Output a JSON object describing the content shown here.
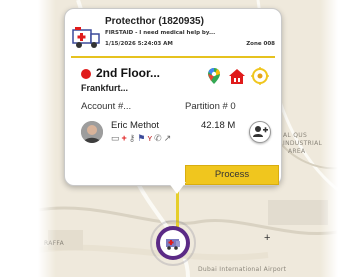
{
  "incident": {
    "title": "Protecthor (1820935)",
    "description": "FIRSTAID - I need medical help by...",
    "datetime": "1/15/2026 5:24:03 AM",
    "zone": "Zone 008"
  },
  "location": {
    "title": "2nd Floor...",
    "city": "Frankfurt...",
    "account_label": "Account #...",
    "partition_label": "Partition # 0"
  },
  "responder": {
    "name": "Eric Methot",
    "distance": "42.18 M"
  },
  "actions": {
    "process_label": "Process"
  },
  "map": {
    "labels": [
      "AL QUS",
      "INDUSTRIAL",
      "AREA",
      "RAFFA",
      "Dubai International Airport"
    ]
  },
  "colors": {
    "accent_yellow": "#f0c61e",
    "alarm_red": "#e01b1b",
    "pin_purple": "#5b2a86"
  },
  "icons": [
    "ambulance-icon",
    "google-maps-icon",
    "house-icon",
    "location-target-icon",
    "assign-user-icon"
  ]
}
